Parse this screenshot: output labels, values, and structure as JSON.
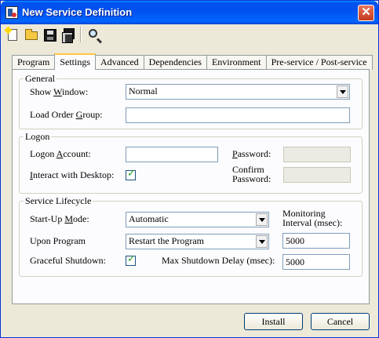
{
  "window": {
    "title": "New Service Definition",
    "close_glyph": "✕"
  },
  "toolbar": {
    "icons": [
      "new-file-icon",
      "open-folder-icon",
      "save-icon",
      "save-all-icon",
      "search-icon"
    ]
  },
  "tabs": [
    {
      "label": "Program",
      "active": false
    },
    {
      "label": "Settings",
      "active": true
    },
    {
      "label": "Advanced",
      "active": false
    },
    {
      "label": "Dependencies",
      "active": false
    },
    {
      "label": "Environment",
      "active": false
    },
    {
      "label": "Pre-service / Post-service",
      "active": false
    }
  ],
  "general": {
    "legend": "General",
    "show_window_pre": "Show ",
    "show_window_key": "W",
    "show_window_post": "indow:",
    "show_window_value": "Normal",
    "load_order_pre": "Load Order ",
    "load_order_key": "G",
    "load_order_post": "roup:",
    "load_order_value": ""
  },
  "logon": {
    "legend": "Logon",
    "account_pre": "Logon ",
    "account_key": "A",
    "account_post": "ccount:",
    "account_value": "",
    "password_key": "P",
    "password_post": "assword:",
    "password_value": "",
    "interact_key": "I",
    "interact_post": "nteract with Desktop:",
    "interact_checked": "✓",
    "confirm_line1": "Confirm",
    "confirm_line2": "Password:",
    "confirm_value": ""
  },
  "lifecycle": {
    "legend": "Service Lifecycle",
    "startup_pre": "Start-Up ",
    "startup_key": "M",
    "startup_post": "ode:",
    "startup_value": "Automatic",
    "monitoring_line1": "Monitoring",
    "monitoring_line2": "Interval (msec):",
    "monitoring_value": "5000",
    "upon_program_label": "Upon Program",
    "upon_program_value": "Restart the Program",
    "graceful_label": "Graceful Shutdown:",
    "graceful_checked": "✓",
    "max_shutdown_label": "Max Shutdown Delay (msec):",
    "max_shutdown_value": "5000"
  },
  "buttons": {
    "install": "Install",
    "cancel": "Cancel"
  }
}
